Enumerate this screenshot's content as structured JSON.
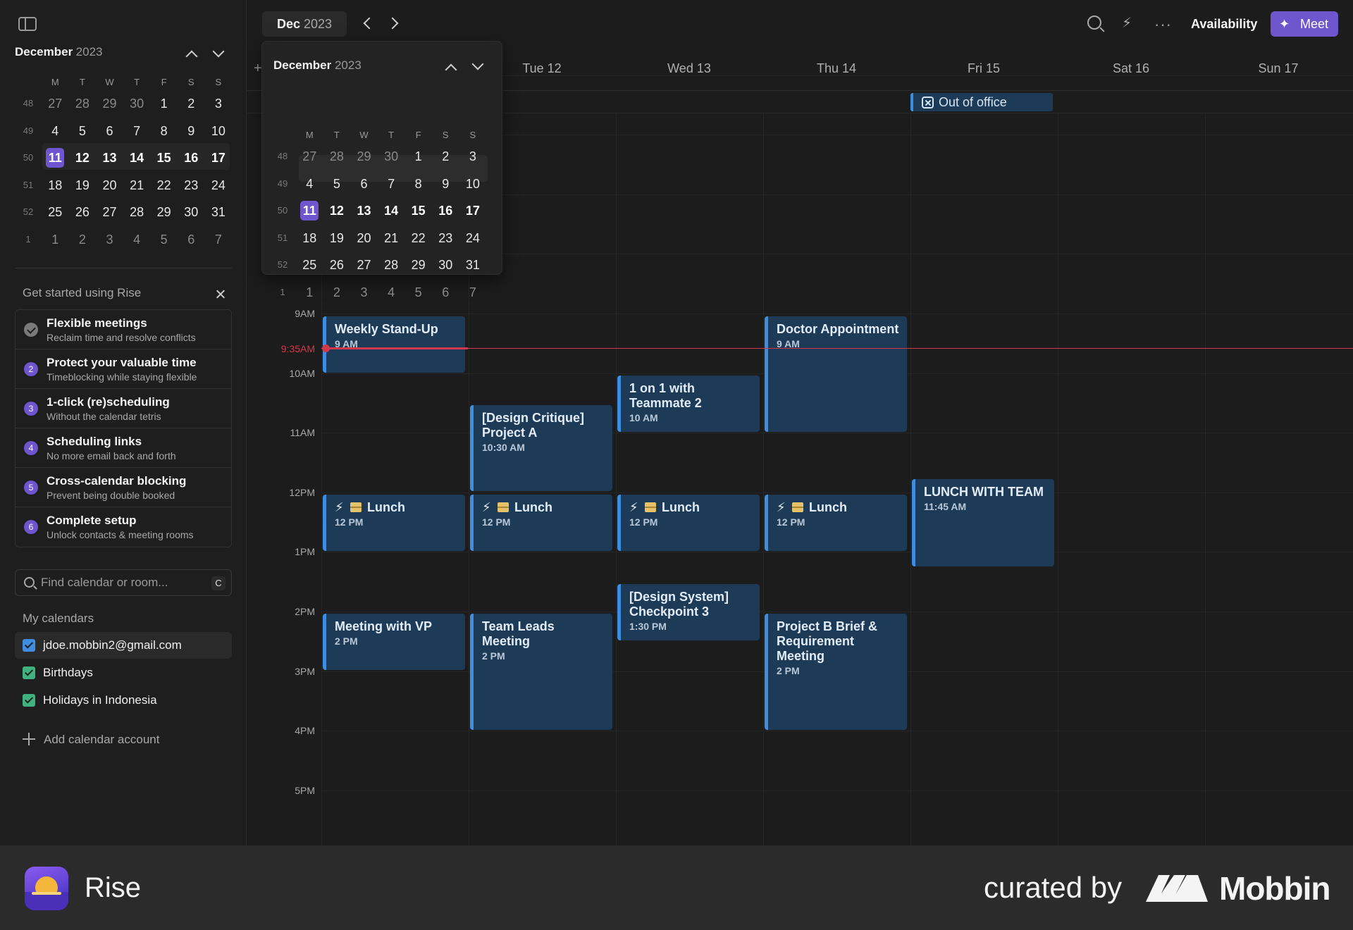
{
  "sidebar": {
    "mini_calendar": {
      "month": "December",
      "year": "2023",
      "weekdays": [
        "M",
        "T",
        "W",
        "T",
        "F",
        "S",
        "S"
      ],
      "weeks": [
        {
          "wk": "48",
          "days": [
            "27",
            "28",
            "29",
            "30",
            "1",
            "2",
            "3"
          ]
        },
        {
          "wk": "49",
          "days": [
            "4",
            "5",
            "6",
            "7",
            "8",
            "9",
            "10"
          ]
        },
        {
          "wk": "50",
          "days": [
            "11",
            "12",
            "13",
            "14",
            "15",
            "16",
            "17"
          ]
        },
        {
          "wk": "51",
          "days": [
            "18",
            "19",
            "20",
            "21",
            "22",
            "23",
            "24"
          ]
        },
        {
          "wk": "52",
          "days": [
            "25",
            "26",
            "27",
            "28",
            "29",
            "30",
            "31"
          ]
        },
        {
          "wk": "1",
          "days": [
            "1",
            "2",
            "3",
            "4",
            "5",
            "6",
            "7"
          ]
        }
      ],
      "selected_day": "11"
    },
    "getting_started": {
      "title": "Get started using Rise",
      "items": [
        {
          "num": "",
          "done": true,
          "title": "Flexible meetings",
          "subtitle": "Reclaim time and resolve conflicts"
        },
        {
          "num": "2",
          "done": false,
          "title": "Protect your valuable time",
          "subtitle": "Timeblocking while staying flexible"
        },
        {
          "num": "3",
          "done": false,
          "title": "1-click (re)scheduling",
          "subtitle": "Without the calendar tetris"
        },
        {
          "num": "4",
          "done": false,
          "title": "Scheduling links",
          "subtitle": "No more email back and forth"
        },
        {
          "num": "5",
          "done": false,
          "title": "Cross-calendar blocking",
          "subtitle": "Prevent being double booked"
        },
        {
          "num": "6",
          "done": false,
          "title": "Complete setup",
          "subtitle": "Unlock contacts & meeting rooms"
        }
      ]
    },
    "search": {
      "placeholder": "Find calendar or room...",
      "shortcut": "C"
    },
    "my_calendars": {
      "title": "My calendars",
      "items": [
        {
          "label": "jdoe.mobbin2@gmail.com",
          "color": "#3f8de0"
        },
        {
          "label": "Birthdays",
          "color": "#3fb27f"
        },
        {
          "label": "Holidays in Indonesia",
          "color": "#3fb27f"
        }
      ],
      "add_label": "Add calendar account"
    }
  },
  "topbar": {
    "month_short": "Dec",
    "year": "2023",
    "availability": "Availability",
    "meet": "Meet"
  },
  "popup": {
    "month": "December",
    "year": "2023"
  },
  "days": [
    "Tue 12",
    "Wed 13",
    "Thu 14",
    "Fri 15",
    "Sat 16",
    "Sun 17"
  ],
  "times": [
    "9AM",
    "10AM",
    "11AM",
    "12PM",
    "1PM",
    "2PM",
    "3PM",
    "4PM",
    "5PM"
  ],
  "now": "9:35AM",
  "all_day": {
    "label": "Out of office"
  },
  "events": [
    {
      "title": "Weekly Stand-Up",
      "time": "9 AM"
    },
    {
      "title": "Doctor Appointment",
      "time": "9 AM"
    },
    {
      "title": "1 on 1 with Teammate 2",
      "time": "10 AM"
    },
    {
      "title": "[Design Critique] Project A",
      "time": "10:30 AM"
    },
    {
      "title": "Lunch",
      "time": "12 PM"
    },
    {
      "title": "Lunch",
      "time": "12 PM"
    },
    {
      "title": "Lunch",
      "time": "12 PM"
    },
    {
      "title": "Lunch",
      "time": "12 PM"
    },
    {
      "title": "LUNCH WITH TEAM",
      "time": "11:45 AM"
    },
    {
      "title": "Meeting with VP",
      "time": "2 PM"
    },
    {
      "title": "Team Leads Meeting",
      "time": "2 PM"
    },
    {
      "title": "[Design System] Checkpoint 3",
      "time": "1:30 PM"
    },
    {
      "title": "Project B Brief & Requirement Meeting",
      "time": "2 PM"
    }
  ],
  "colors": {
    "accent": "#6e56cf",
    "event_bg": "#1d3a56",
    "event_border": "#3f8de0",
    "now_line": "#d2384c"
  },
  "footer": {
    "app_name": "Rise",
    "curated_by": "curated by",
    "brand": "Mobbin"
  }
}
